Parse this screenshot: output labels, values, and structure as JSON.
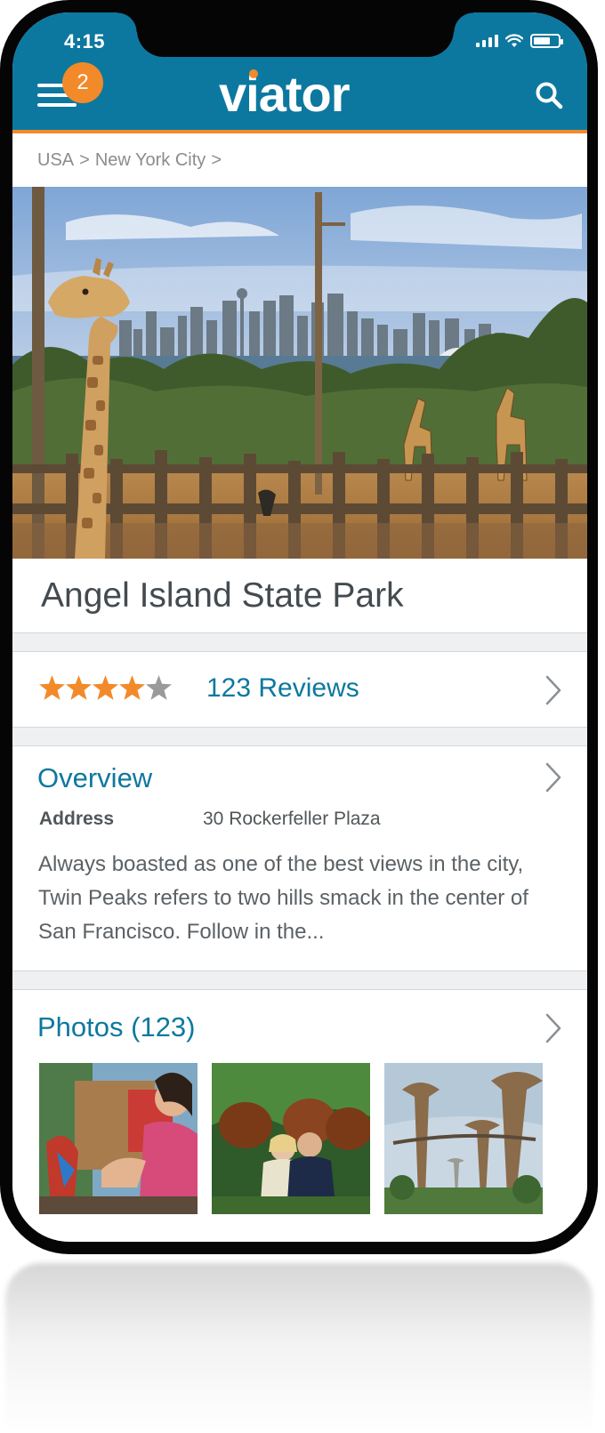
{
  "status_bar": {
    "time": "4:15"
  },
  "header": {
    "menu_badge_count": "2",
    "logo_text": "viator",
    "brand_color": "#0d789f",
    "accent_color": "#f28a2a",
    "icons": {
      "menu": "hamburger-menu-icon",
      "search": "search-icon"
    }
  },
  "breadcrumb": {
    "items": [
      "USA",
      "New York City"
    ],
    "separator": ">"
  },
  "attraction": {
    "title": "Angel Island State Park",
    "rating": 4,
    "rating_max": 5,
    "reviews_label": "123 Reviews"
  },
  "overview": {
    "heading": "Overview",
    "address_label": "Address",
    "address_value": "30 Rockerfeller Plaza",
    "description": "Always boasted as one of the best views in the city, Twin Peaks refers to two hills smack in the center of San Francisco. Follow in the..."
  },
  "photos": {
    "heading": "Photos (123)"
  }
}
